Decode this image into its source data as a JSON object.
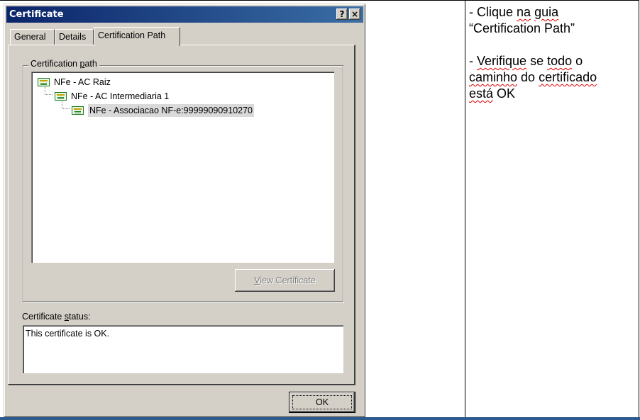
{
  "dialog": {
    "title": "Certificate",
    "help_glyph": "?",
    "close_glyph": "×",
    "tabs": [
      {
        "label": "General"
      },
      {
        "label": "Details"
      },
      {
        "label": "Certification Path",
        "selected": true
      }
    ],
    "certification_path": {
      "label_before": "Certification ",
      "label_accel": "p",
      "label_after": "ath",
      "nodes": [
        {
          "label": "NFe - AC Raiz",
          "icon": "certificate-icon"
        },
        {
          "label": "NFe - AC Intermediaria 1",
          "icon": "certificate-icon"
        },
        {
          "label": "NFe - Associacao NF-e:99999090910270",
          "icon": "certificate-icon",
          "selected": true
        }
      ]
    },
    "view_certificate": {
      "accel": "V",
      "rest": "iew Certificate",
      "enabled": false
    },
    "status": {
      "label_before": "Certificate ",
      "label_accel": "s",
      "label_after": "tatus:",
      "text": "This certificate is OK."
    },
    "ok_label": "OK"
  },
  "instructions": {
    "step1": {
      "prefix": "- Clique ",
      "w1": "na",
      "mid": " ",
      "w2": "guia",
      "line2": "“Certification Path”"
    },
    "step2": {
      "prefix": "- ",
      "w1": "Verifique",
      "t1": " se ",
      "w2": "todo",
      "t2": " o",
      "w3": "caminho",
      "t3": " do ",
      "w4": "certificado",
      "w5": "está",
      "t4": " OK"
    }
  },
  "colors": {
    "titlebar_start": "#0a246a",
    "titlebar_end": "#3a6ea5",
    "dialog_face": "#d4d0c8",
    "spellcheck_underline": "#e00000",
    "bottom_band": "#2f5b8c"
  }
}
